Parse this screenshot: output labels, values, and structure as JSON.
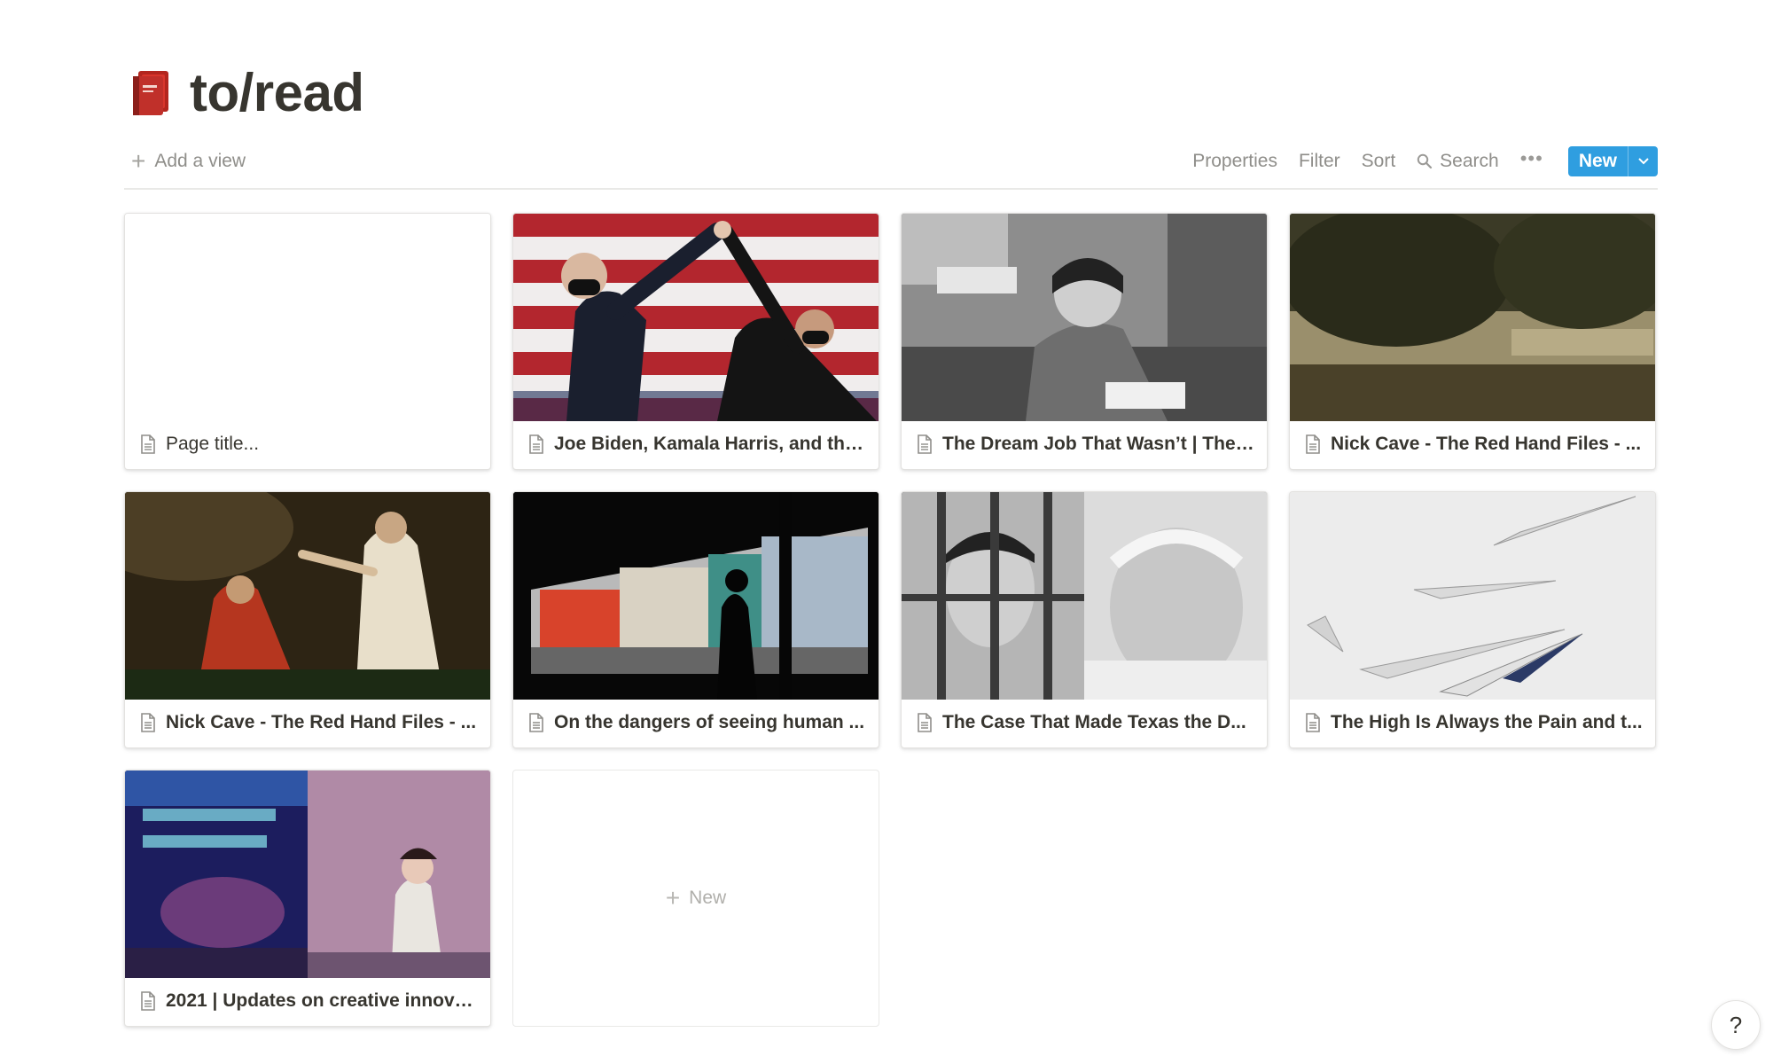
{
  "page": {
    "title": "to/read",
    "icon": "red-book-icon"
  },
  "toolbar": {
    "add_view": "Add a view",
    "properties": "Properties",
    "filter": "Filter",
    "sort": "Sort",
    "search": "Search",
    "more": "•••",
    "new": "New"
  },
  "cards": [
    {
      "title": "Page title...",
      "cover": "none"
    },
    {
      "title": "Joe Biden, Kamala Harris, and the...",
      "cover": "biden-harris-photo"
    },
    {
      "title": "The Dream Job That Wasn’t | The ...",
      "cover": "office-worker-photo"
    },
    {
      "title": "Nick Cave - The Red Hand Files - ...",
      "cover": "forest-painting"
    },
    {
      "title": "Nick Cave - The Red Hand Files - ...",
      "cover": "religious-painting"
    },
    {
      "title": "On the dangers of seeing human ...",
      "cover": "city-silhouette-photo"
    },
    {
      "title": "The Case That Made Texas the D...",
      "cover": "prisoner-photo"
    },
    {
      "title": "The High Is Always the Pain and t...",
      "cover": "paper-planes-photo"
    },
    {
      "title": "2021 | Updates on creative innova...",
      "cover": "livestream-screenshot"
    }
  ],
  "new_card": {
    "label": "New"
  },
  "help": {
    "label": "?"
  },
  "colors": {
    "accent": "#2f9ee0",
    "text": "#37352f",
    "muted": "#8f8e8a",
    "border": "#e9e9e7"
  }
}
